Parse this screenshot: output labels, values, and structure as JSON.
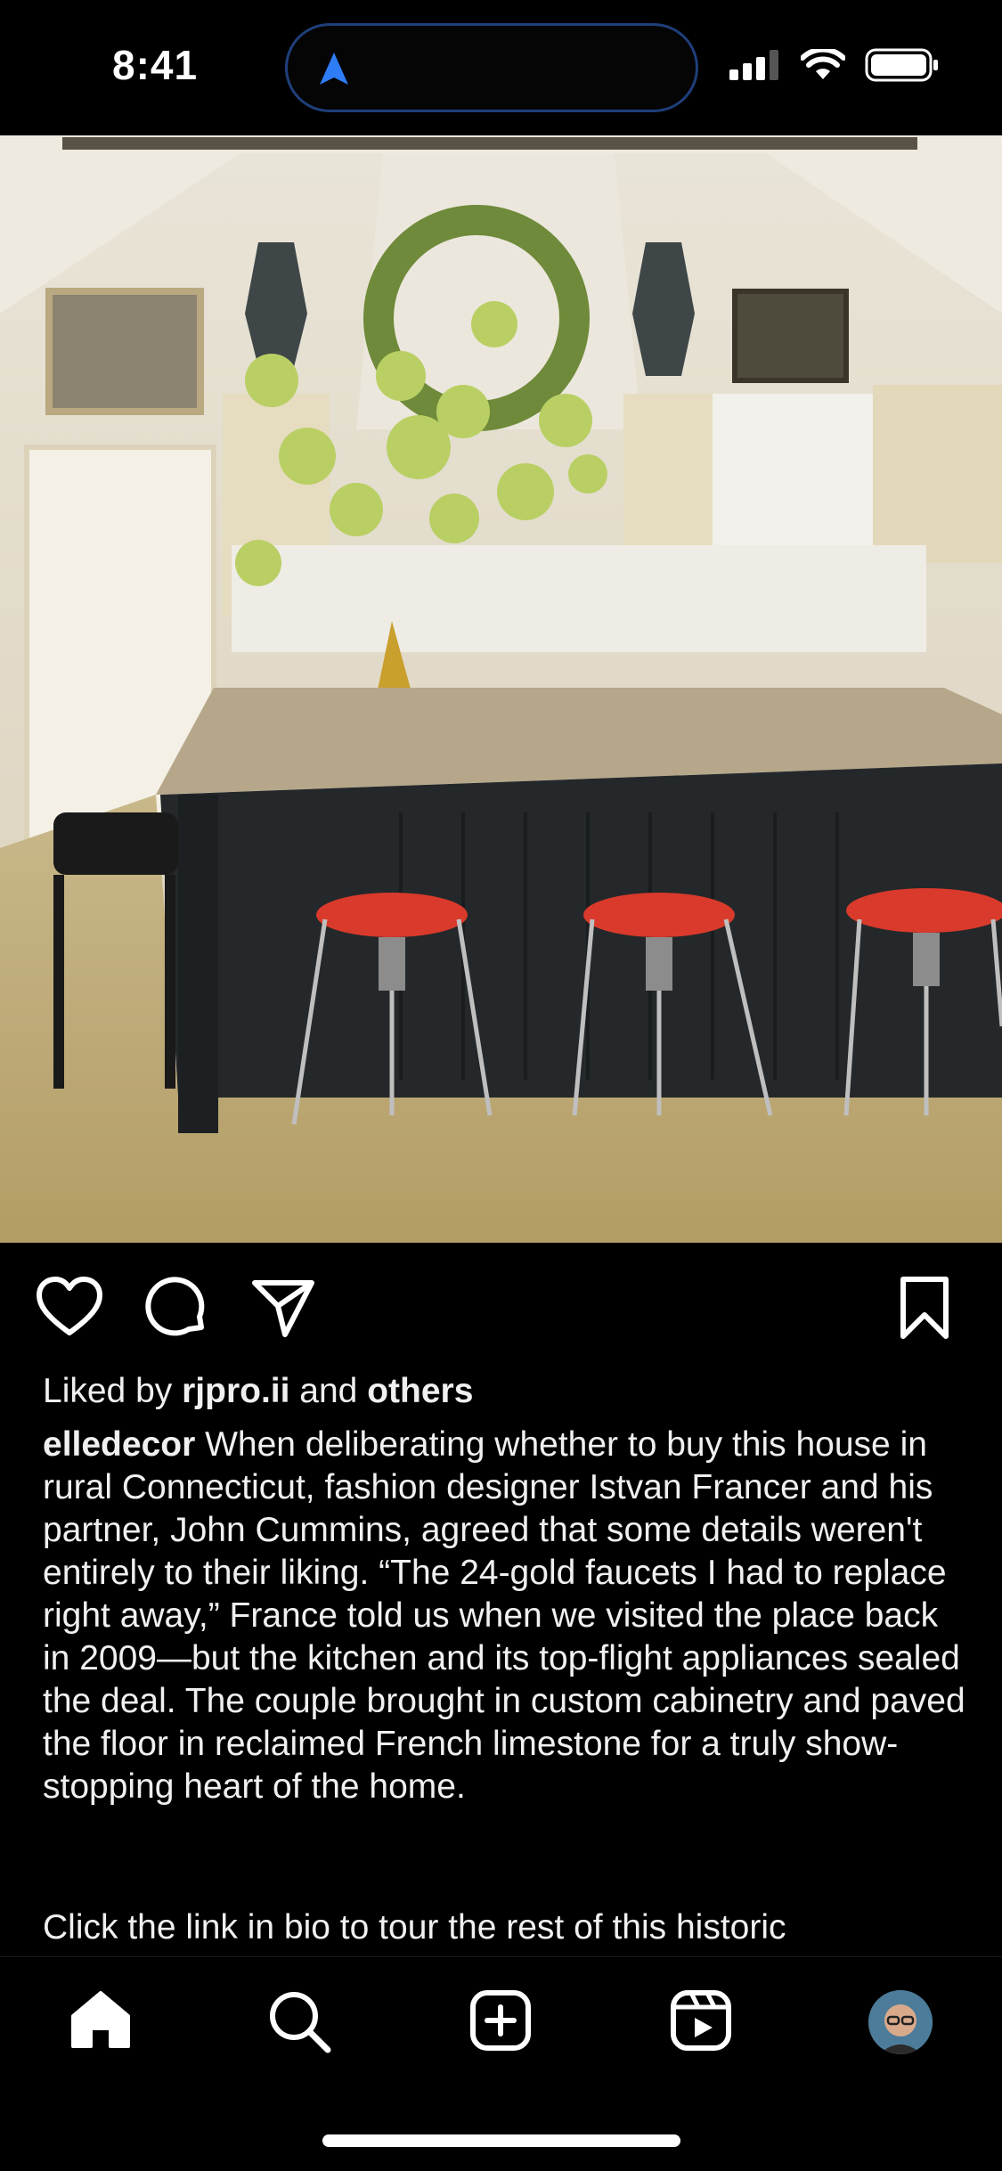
{
  "status_bar": {
    "time": "8:41"
  },
  "post": {
    "image_icon": "kitchen-photo",
    "liked_by_prefix": "Liked by ",
    "liked_by_user": "rjpro.ii",
    "liked_by_mid": " and ",
    "liked_by_others": "others",
    "author": "elledecor",
    "caption": " When deliberating whether to buy this house in rural Connecticut, fashion designer Istvan Francer and his partner, John Cummins, agreed that some details weren't entirely to their liking. “The 24-gold faucets I had to replace right away,” France told us when we visited the place back in 2009—but the kitchen and its top-flight appliances sealed the deal. The couple brought in custom cabinetry and paved the floor in reclaimed French limestone for a truly show-stopping heart of the home.",
    "caption_continued": "Click the link in bio to tour the rest of this historic"
  },
  "actions": {
    "like_icon": "heart-icon",
    "comment_icon": "comment-icon",
    "share_icon": "paper-plane-icon",
    "save_icon": "bookmark-icon"
  },
  "tab_bar": {
    "items": [
      "home-icon",
      "search-icon",
      "create-icon",
      "reels-icon",
      "profile-avatar"
    ]
  },
  "colors": {
    "background": "#000000",
    "text": "#f0f0f0",
    "island_border": "#1f3f7a",
    "location_arrow": "#2f7df6"
  }
}
